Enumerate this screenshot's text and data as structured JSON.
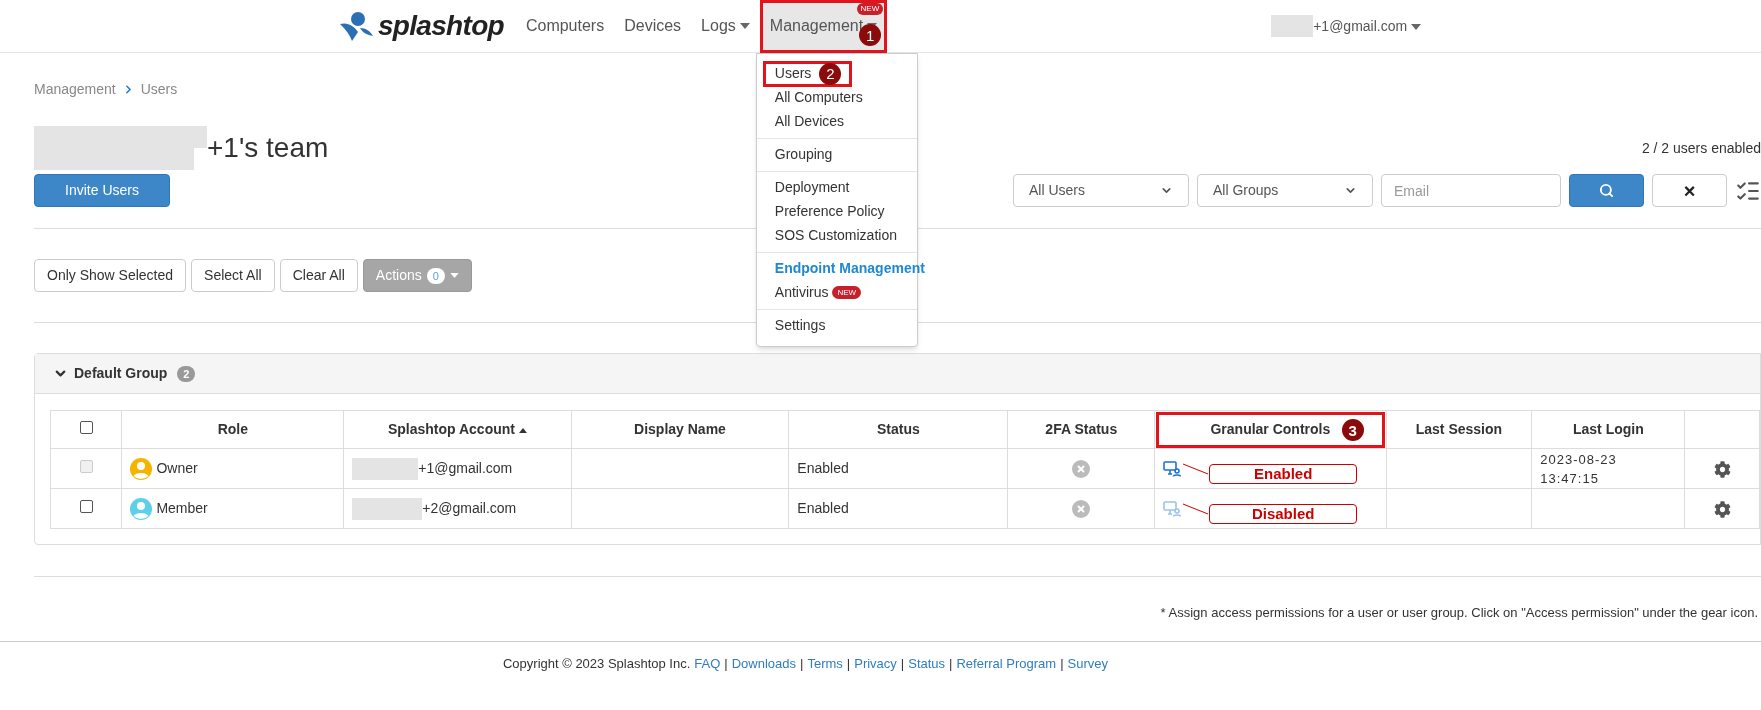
{
  "header": {
    "logo": "splashtop",
    "nav": [
      {
        "label": "Computers",
        "selected": false,
        "caret": false
      },
      {
        "label": "Devices",
        "selected": false,
        "caret": false
      },
      {
        "label": "Logs",
        "selected": false,
        "caret": true
      },
      {
        "label": "Management",
        "selected": true,
        "caret": true,
        "badge": "NEW",
        "annotation": "1"
      }
    ],
    "account": "+1@gmail.com"
  },
  "menu": {
    "sections": [
      [
        {
          "label": "Users",
          "kind": "link",
          "annotation": "2"
        },
        {
          "label": "All Computers",
          "kind": "link"
        },
        {
          "label": "All Devices",
          "kind": "link"
        }
      ],
      [
        {
          "label": "Grouping",
          "kind": "link"
        }
      ],
      [
        {
          "label": "Deployment",
          "kind": "link"
        },
        {
          "label": "Preference Policy",
          "kind": "link"
        },
        {
          "label": "SOS Customization",
          "kind": "link"
        }
      ],
      [
        {
          "label": "Endpoint Management",
          "kind": "heading"
        },
        {
          "label": "Antivirus",
          "kind": "link",
          "badge": "NEW"
        }
      ],
      [
        {
          "label": "Settings",
          "kind": "link"
        }
      ]
    ]
  },
  "breadcrumb": [
    "Management",
    "Users"
  ],
  "team_title": "+1's team",
  "users_enabled": "2 / 2 users enabled",
  "invite_button": "Invite Users",
  "filters": {
    "user_select": "All Users",
    "group_select": "All Groups",
    "email": {
      "placeholder": "Email"
    },
    "clear": "×"
  },
  "toolbar": {
    "buttons": [
      "Only Show Selected",
      "Select All",
      "Clear All"
    ],
    "actions": {
      "label": "Actions",
      "count": "0"
    }
  },
  "group": {
    "name": "Default Group",
    "count": "2",
    "expanded": true,
    "all_checked": false,
    "columns": [
      {
        "label": "Role",
        "sorted": false
      },
      {
        "label": "Splashtop Account",
        "sorted": true
      },
      {
        "label": "Display Name",
        "sorted": false
      },
      {
        "label": "Status",
        "sorted": false
      },
      {
        "label": "2FA Status",
        "sorted": false
      },
      {
        "label": "Granular Controls",
        "sorted": false,
        "annotation": "3"
      },
      {
        "label": "Last Session",
        "sorted": false
      },
      {
        "label": "Last Login",
        "sorted": false
      }
    ],
    "rows": [
      {
        "checked": false,
        "disabled": true,
        "role": "Owner",
        "kind": "owner",
        "account": "+1@gmail.com",
        "status": "Enabled",
        "twofa_enabled": false,
        "granular_enabled": true,
        "callout": "Enabled",
        "last_login": "2023-08-23 13:47:15"
      },
      {
        "checked": false,
        "disabled": false,
        "role": "Member",
        "kind": "member",
        "account": "+2@gmail.com",
        "status": "Enabled",
        "twofa_enabled": false,
        "granular_enabled": false,
        "callout": "Disabled"
      }
    ]
  },
  "note": "* Assign access permissions for a user or user group. Click on \"Access permission\" under the gear icon.",
  "footer": {
    "items": [
      {
        "text": "Copyright © 2023 Splashtop Inc.",
        "kind": "text"
      },
      {
        "text": "FAQ",
        "kind": "link"
      },
      {
        "text": "|",
        "kind": "separator"
      },
      {
        "text": "Downloads",
        "kind": "link"
      },
      {
        "text": "|",
        "kind": "separator"
      },
      {
        "text": "Terms",
        "kind": "link"
      },
      {
        "text": "|",
        "kind": "separator"
      },
      {
        "text": "Privacy",
        "kind": "link"
      },
      {
        "text": "|",
        "kind": "separator"
      },
      {
        "text": "Status",
        "kind": "link"
      },
      {
        "text": "|",
        "kind": "separator"
      },
      {
        "text": "Referral Program",
        "kind": "link"
      },
      {
        "text": "|",
        "kind": "separator"
      },
      {
        "text": "Survey",
        "kind": "link"
      }
    ]
  }
}
